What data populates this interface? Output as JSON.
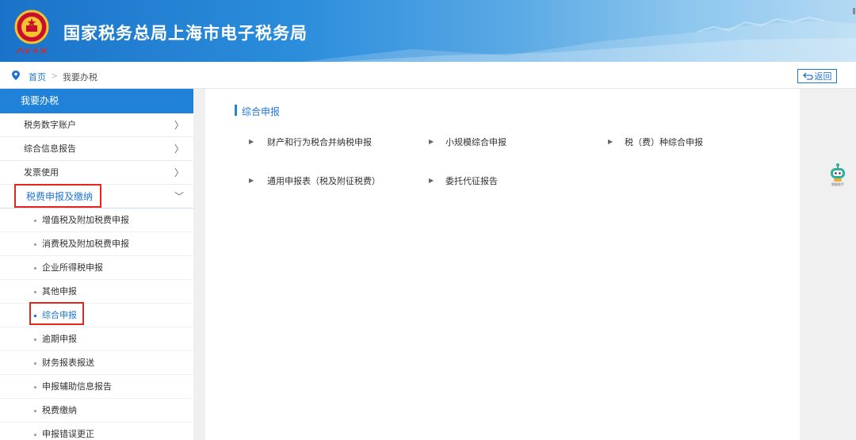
{
  "header": {
    "title": "国家税务总局上海市电子税务局",
    "emblem_caption": "中国税务"
  },
  "breadcrumb": {
    "home": "首页",
    "separator": ">",
    "current": "我要办税",
    "back_label": "返回"
  },
  "sidebar": {
    "heading": "我要办税",
    "items": [
      {
        "label": "税务数字账户",
        "chevron": "〉"
      },
      {
        "label": "综合信息报告",
        "chevron": "〉"
      },
      {
        "label": "发票使用",
        "chevron": "〉"
      }
    ],
    "open_item": {
      "label": "税费申报及缴纳",
      "chevron": "﹀"
    },
    "sub_items": [
      {
        "label": "增值税及附加税费申报"
      },
      {
        "label": "消费税及附加税费申报"
      },
      {
        "label": "企业所得税申报"
      },
      {
        "label": "其他申报"
      },
      {
        "label": "综合申报"
      },
      {
        "label": "逾期申报"
      },
      {
        "label": "财务报表报送"
      },
      {
        "label": "申报辅助信息报告"
      },
      {
        "label": "税费缴纳"
      },
      {
        "label": "申报错误更正"
      }
    ]
  },
  "main": {
    "section_title": "综合申报",
    "links": [
      {
        "label": "财产和行为税合并纳税申报"
      },
      {
        "label": "小规模综合申报"
      },
      {
        "label": "税（费）种综合申报"
      },
      {
        "label": "通用申报表（税及附征税费）"
      },
      {
        "label": "委托代征报告"
      }
    ]
  },
  "assistant": {
    "caption": "智能助手"
  },
  "colors": {
    "primary": "#1f76d2",
    "highlight": "#e5271b",
    "header_start": "#1a73c8"
  }
}
